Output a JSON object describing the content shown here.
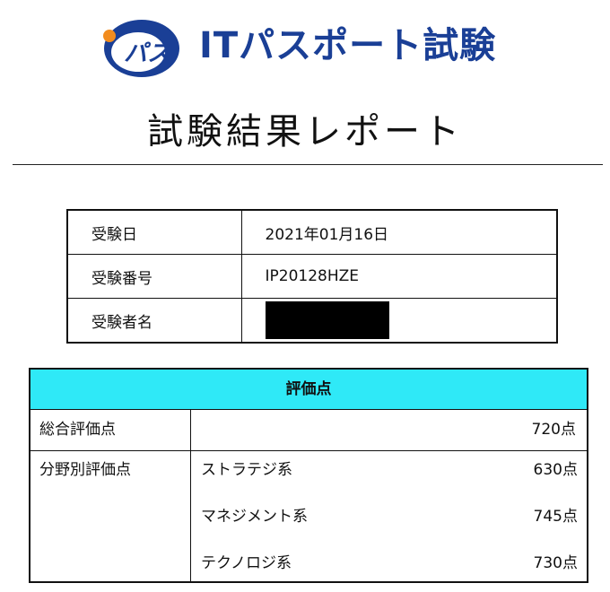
{
  "header": {
    "logo_text": "パス",
    "title": "ITパスポート試験"
  },
  "report_title": "試験結果レポート",
  "info": {
    "exam_date_label": "受験日",
    "exam_date_value": "2021年01月16日",
    "exam_number_label": "受験番号",
    "exam_number_value": "IP20128HZE",
    "examinee_name_label": "受験者名"
  },
  "score": {
    "header": "評価点",
    "total_label": "総合評価点",
    "total_value": "720点",
    "field_label": "分野別評価点",
    "fields": [
      {
        "name": "ストラテジ系",
        "value": "630点"
      },
      {
        "name": "マネジメント系",
        "value": "745点"
      },
      {
        "name": "テクノロジ系",
        "value": "730点"
      }
    ]
  },
  "colors": {
    "brand_blue": "#1a3f96",
    "logo_orange": "#f28c1e",
    "header_cyan": "#2fe9f7"
  }
}
